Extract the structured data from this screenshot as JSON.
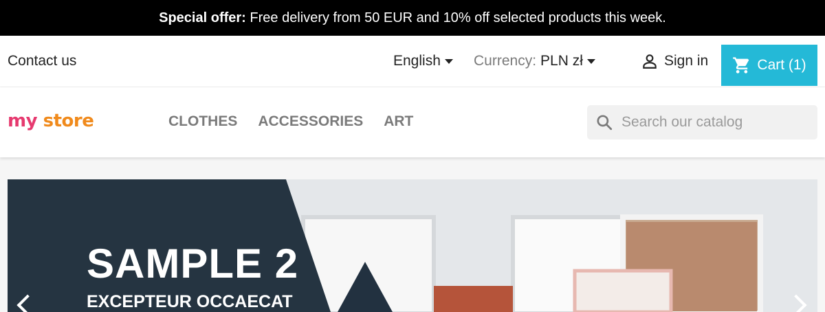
{
  "promo": {
    "strong": "Special offer:",
    "text": " Free delivery from 50 EUR and 10% off selected products this week."
  },
  "topnav": {
    "contact": "Contact us",
    "language": "English",
    "currency_label": "Currency:",
    "currency_value": "PLN zł",
    "signin": "Sign in",
    "cart": "Cart (1)",
    "cart_color": "#24b9d7"
  },
  "logo": {
    "parts": [
      "my",
      " ",
      "store"
    ]
  },
  "menu": {
    "items": [
      "Clothes",
      "Accessories",
      "Art"
    ]
  },
  "search": {
    "placeholder": "Search our catalog"
  },
  "slide": {
    "title": "SAMPLE 2",
    "subtitle": "EXCEPTEUR OCCAECAT"
  }
}
